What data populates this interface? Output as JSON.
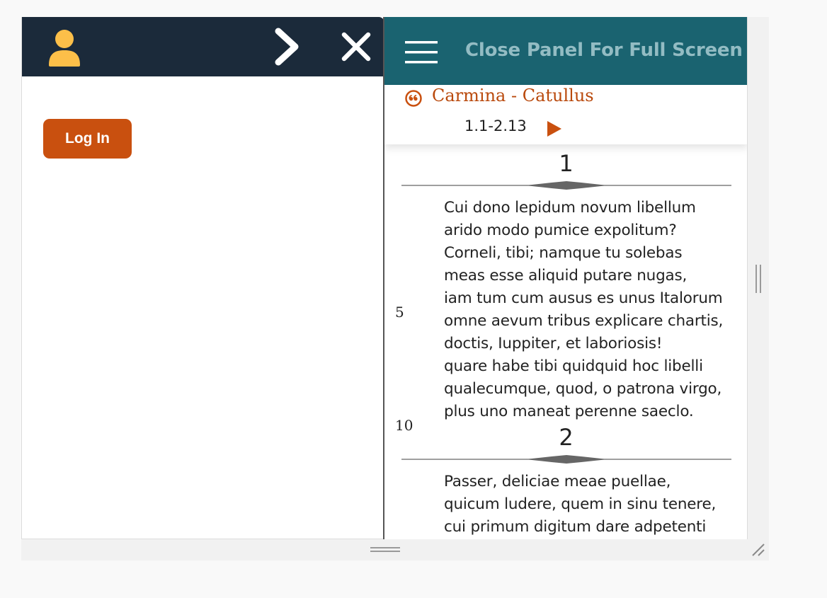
{
  "left_panel": {
    "login_label": "Log In"
  },
  "right_panel": {
    "header_label": "Close Panel For Full Screen",
    "work_title": "Carmina - Catullus",
    "range": "1.1-2.13"
  },
  "poems": [
    {
      "number": "1",
      "lines": [
        {
          "n": "",
          "text": "Cui dono lepidum novum libellum"
        },
        {
          "n": "",
          "text": "arido modo pumice expolitum?"
        },
        {
          "n": "",
          "text": "Corneli, tibi; namque tu solebas"
        },
        {
          "n": "",
          "text": "meas esse aliquid putare nugas,"
        },
        {
          "n": "5",
          "text": "iam tum cum ausus es unus Italorum"
        },
        {
          "n": "",
          "text": "omne aevum tribus explicare chartis,"
        },
        {
          "n": "",
          "text": "doctis, Iuppiter, et laboriosis!"
        },
        {
          "n": "",
          "text": "quare habe tibi quidquid hoc libelli"
        },
        {
          "n": "",
          "text": "qualecumque, quod, o patrona virgo,"
        },
        {
          "n": "10",
          "text": "plus uno maneat perenne saeclo."
        }
      ]
    },
    {
      "number": "2",
      "lines": [
        {
          "n": "",
          "text": "Passer, deliciae meae puellae,"
        },
        {
          "n": "",
          "text": "quicum ludere, quem in sinu tenere,"
        },
        {
          "n": "",
          "text": "cui primum digitum dare adpetenti"
        }
      ]
    }
  ],
  "colors": {
    "left_header": "#1b2a3a",
    "right_header": "#1a6370",
    "accent": "#c9500f",
    "title": "#b9490c",
    "user_icon": "#fcbf49"
  },
  "icons": {
    "user": "user-icon",
    "expand": "chevron-right-icon",
    "close": "close-icon",
    "menu": "hamburger-icon",
    "quote": "quote-icon",
    "play": "play-icon"
  }
}
